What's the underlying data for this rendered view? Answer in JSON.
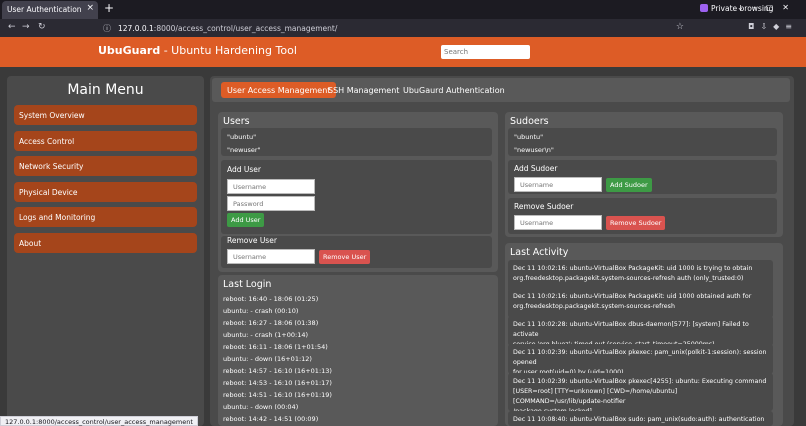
{
  "browser": {
    "tab_title": "User Authentication",
    "tab_close": "×",
    "new_tab": "+",
    "private_label": "Private browsing",
    "url_host": "127.0.0.1",
    "url_path": ":8000/access_control/user_access_management/",
    "status_url": "127.0.0.1:8000/access_control/user_access_management"
  },
  "header": {
    "app_name": "UbuGuard",
    "subtitle": " - Ubuntu Hardening Tool",
    "search_placeholder": "Search"
  },
  "sidebar": {
    "title": "Main Menu",
    "items": [
      {
        "label": "System Overview"
      },
      {
        "label": "Access Control"
      },
      {
        "label": "Network Security"
      },
      {
        "label": "Physical Device"
      },
      {
        "label": "Logs and Monitoring"
      },
      {
        "label": "About"
      }
    ]
  },
  "tabs": [
    {
      "label": "User Access Management",
      "active": true
    },
    {
      "label": "SSH Management",
      "active": false
    },
    {
      "label": "UbuGaurd Authentication",
      "active": false
    }
  ],
  "users": {
    "title": "Users",
    "list": [
      "\"ubuntu\"",
      "\"newuser\""
    ],
    "add_title": "Add User",
    "username_placeholder": "Username",
    "password_placeholder": "Password",
    "add_button": "Add User",
    "remove_title": "Remove User",
    "remove_placeholder": "Username",
    "remove_button": "Remove User"
  },
  "sudoers": {
    "title": "Sudoers",
    "list": [
      "\"ubuntu\"",
      "\"newuser\\n\""
    ],
    "add_title": "Add Sudoer",
    "add_placeholder": "Username",
    "add_button": "Add Sudoer",
    "remove_title": "Remove Sudoer",
    "remove_placeholder": "Username",
    "remove_button": "Remove Sudoer"
  },
  "last_login": {
    "title": "Last Login",
    "entries": [
      "reboot: 16:40 - 18:06 (01:25)",
      "ubuntu: - crash (00:10)",
      "reboot: 16:27 - 18:06 (01:38)",
      "ubuntu: - crash (1+00:14)",
      "reboot: 16:11 - 18:06 (1+01:54)",
      "ubuntu: - down (16+01:12)",
      "reboot: 14:57 - 16:10 (16+01:13)",
      "reboot: 14:53 - 16:10 (16+01:17)",
      "reboot: 14:51 - 16:10 (16+01:19)",
      "ubuntu: - down (00:04)",
      "reboot: 14:42 - 14:51 (00:09)"
    ]
  },
  "last_activity": {
    "title": "Last Activity",
    "entries": [
      {
        "l1": "Dec 11 10:02:16: ubuntu-VirtualBox PackageKit: uid 1000 is trying to obtain",
        "l2": "org.freedesktop.packagekit.system-sources-refresh auth (only_trusted:0)"
      },
      {
        "l1": "Dec 11 10:02:16: ubuntu-VirtualBox PackageKit: uid 1000 obtained auth for",
        "l2": "org.freedesktop.packagekit.system-sources-refresh"
      },
      {
        "l1": "Dec 11 10:02:28: ubuntu-VirtualBox dbus-daemon[577]: [system] Failed to activate",
        "l2": "service 'org.bluez': timed out (service_start_timeout=25000ms)"
      },
      {
        "l1": "Dec 11 10:02:39: ubuntu-VirtualBox pkexec: pam_unix(polkit-1:session): session opened",
        "l2": "for user root(uid=0) by (uid=1000)"
      },
      {
        "l1": "Dec 11 10:02:39: ubuntu-VirtualBox pkexec[4255]: ubuntu: Executing command",
        "l2": "[USER=root] [TTY=unknown] [CWD=/home/ubuntu] [COMMAND=/usr/lib/update-notifier",
        "l3": "/package-system-locked]"
      },
      {
        "l1": "Dec 11 10:08:40: ubuntu-VirtualBox sudo: pam_unix(sudo:auth): authentication failure;",
        "l2": ""
      }
    ]
  }
}
